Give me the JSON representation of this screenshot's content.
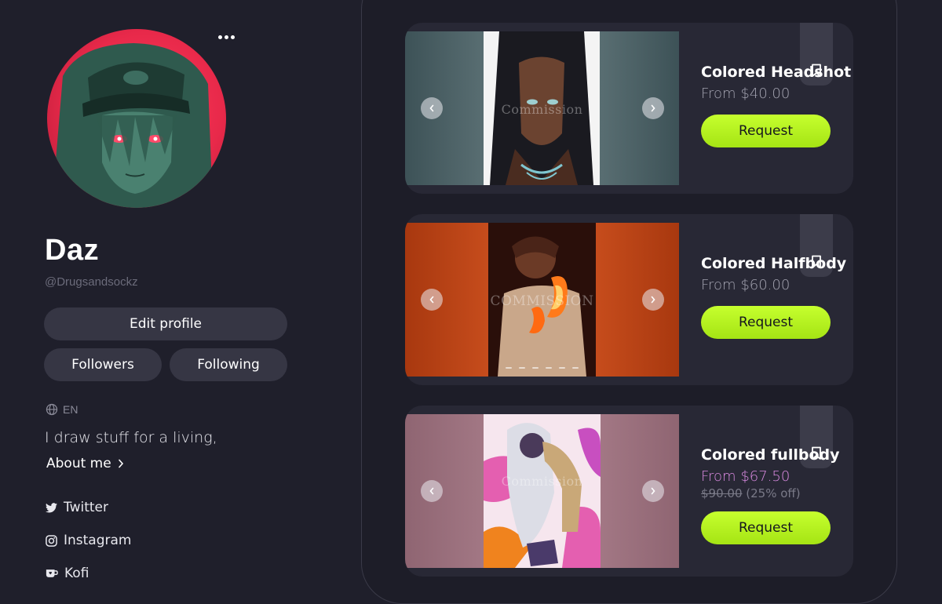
{
  "profile": {
    "name": "Daz",
    "handle": "@Drugsandsockz",
    "edit_label": "Edit profile",
    "followers_label": "Followers",
    "following_label": "Following",
    "language": "EN",
    "bio": "I draw stuff for a living,",
    "about_label": "About me",
    "more_icon": "more-horizontal-icon"
  },
  "socials": [
    {
      "label": "Twitter",
      "icon": "twitter-icon"
    },
    {
      "label": "Instagram",
      "icon": "instagram-icon"
    },
    {
      "label": "Kofi",
      "icon": "kofi-cup-icon"
    }
  ],
  "shop": {
    "items": [
      {
        "title": "Colored Headshot",
        "price": "From $40.00",
        "request_label": "Request",
        "watermark": "Commission",
        "bg_color": "#4f6468",
        "art_color": "#2a2220"
      },
      {
        "title": "Colored Halfbody",
        "price": "From $60.00",
        "request_label": "Request",
        "watermark": "COMMISSION",
        "bg_color": "#c0461a",
        "art_color": "#3a140c"
      },
      {
        "title": "Colored fullbody",
        "price": "From $67.50",
        "original_price": "$90.00",
        "discount": "(25% off)",
        "request_label": "Request",
        "watermark": "Commission",
        "bg_color": "#a37885",
        "art_color": "#e45fb0"
      }
    ]
  },
  "colors": {
    "background": "#1f1f2b",
    "card": "#282835",
    "accent": "#b8f521",
    "sale_price": "#d98ae0",
    "avatar_bg": "#e8294a"
  }
}
